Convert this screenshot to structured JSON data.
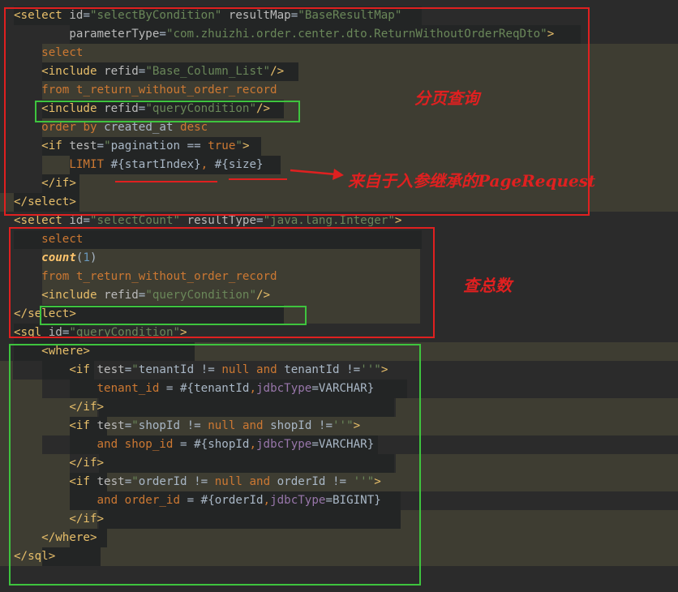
{
  "notes": {
    "paging_query": "分页查询",
    "from_page_request": "来自于入参继承的PageRequest",
    "total_count": "查总数"
  },
  "colors": {
    "annotation_red": "#e02020",
    "annotation_green": "#3ec43e",
    "editor_background": "#2b2b2b",
    "line_highlight": "#3e3d32"
  },
  "code_lines": [
    "<select id=\"selectByCondition\" resultMap=\"BaseResultMap\"",
    "        parameterType=\"com.zhuizhi.order.center.dto.ReturnWithoutOrderReqDto\">",
    "    select",
    "    <include refid=\"Base_Column_List\"/>",
    "    from t_return_without_order_record",
    "    <include refid=\"queryCondition\"/>",
    "    order by created_at desc",
    "    <if test=\"pagination == true\">",
    "        LIMIT #{startIndex}, #{size}",
    "    </if>",
    "</select>",
    "",
    "<select id=\"selectCount\" resultType=\"java.lang.Integer\">",
    "    select",
    "    count(1)",
    "    from t_return_without_order_record",
    "    <include refid=\"queryCondition\"/>",
    "</select>",
    "<sql id=\"queryCondition\">",
    "    <where>",
    "        <if test=\"tenantId != null and tenantId !=''\">",
    "            tenant_id = #{tenantId,jdbcType=VARCHAR}",
    "        </if>",
    "        <if test=\"shopId != null and shopId !=''\">",
    "            and shop_id = #{shopId,jdbcType=VARCHAR}",
    "        </if>",
    "        <if test=\"orderId != null and orderId != ''\">",
    "            and order_id = #{orderId,jdbcType=BIGINT}",
    "        </if>",
    "    </where>",
    "</sql>"
  ]
}
